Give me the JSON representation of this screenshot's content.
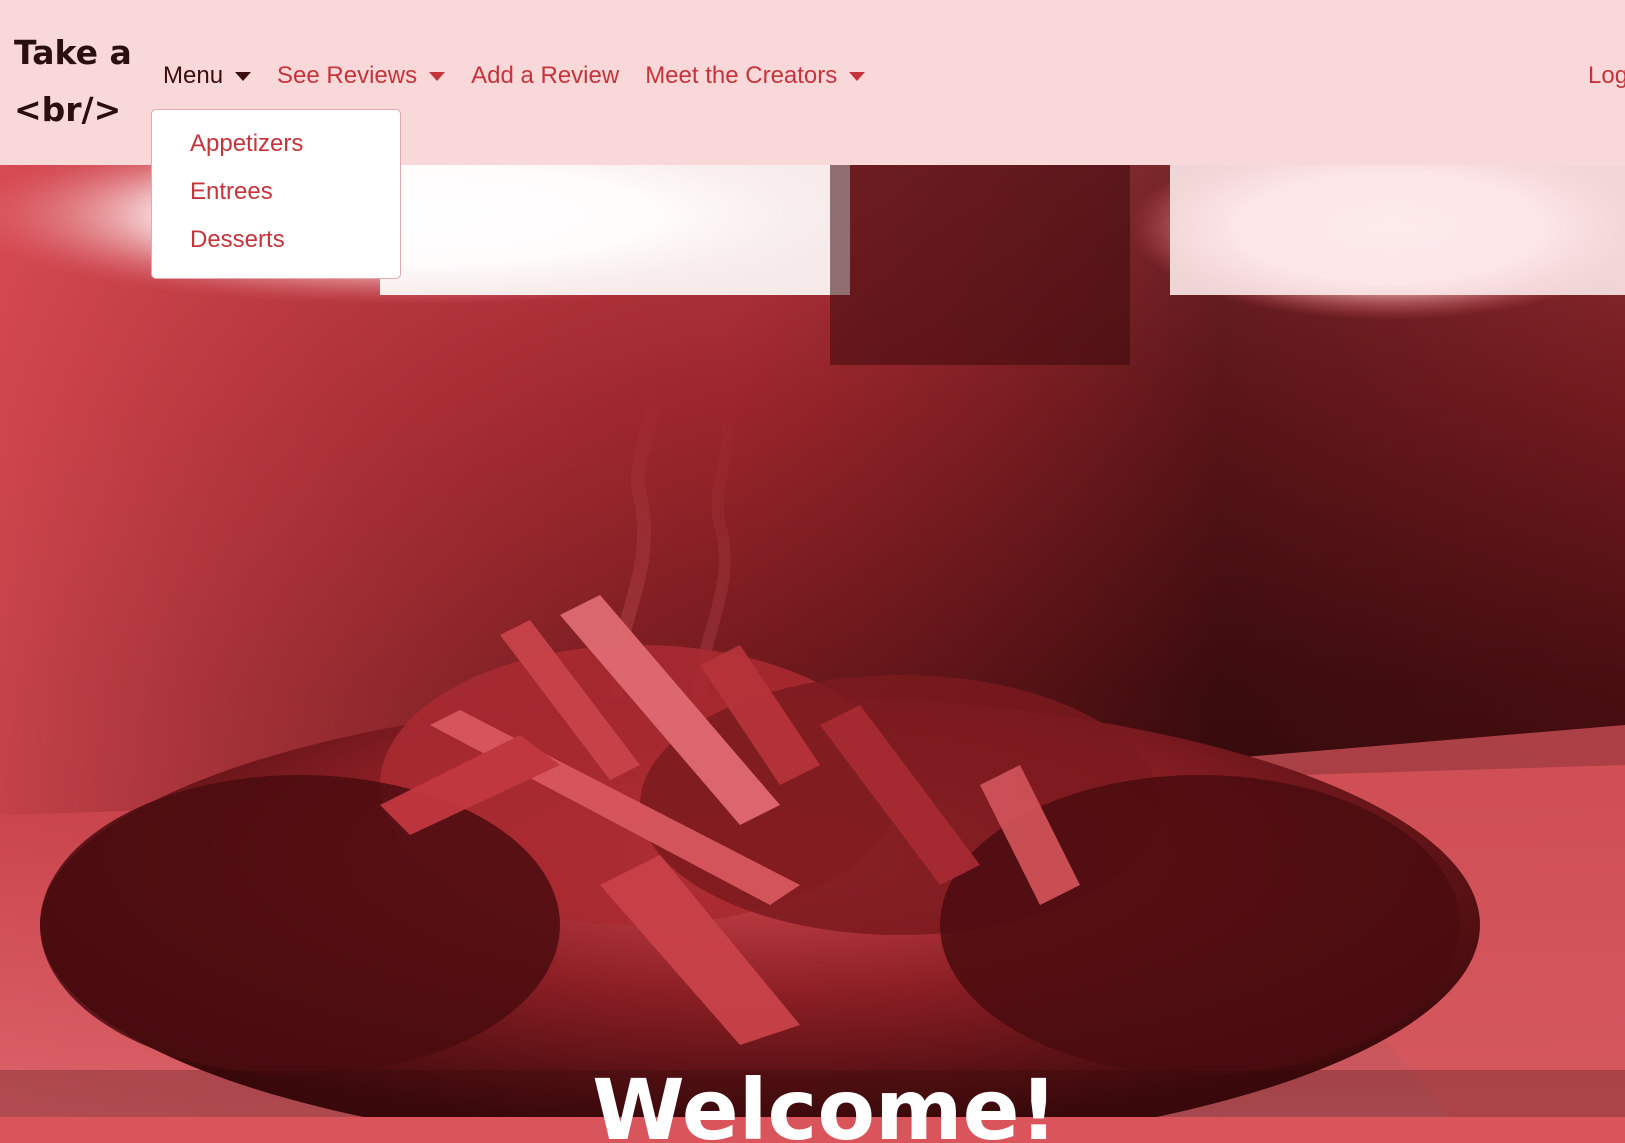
{
  "brand": {
    "line1": "Take a",
    "line2": "<br/>"
  },
  "nav": {
    "items": [
      {
        "label": "Menu",
        "has_caret": true,
        "active": true
      },
      {
        "label": "See Reviews",
        "has_caret": true,
        "active": false
      },
      {
        "label": "Add a Review",
        "has_caret": false,
        "active": false
      },
      {
        "label": "Meet the Creators",
        "has_caret": true,
        "active": false
      }
    ],
    "right_label": "Log"
  },
  "dropdown": {
    "items": [
      "Appetizers",
      "Entrees",
      "Desserts"
    ]
  },
  "hero": {
    "heading": "Welcome!"
  },
  "colors": {
    "navbar_bg": "#f8d8d9",
    "link": "#c6343b",
    "active_link": "#3b0d0f",
    "hero_tint": "#c8353c",
    "bottom_bar": "#d9545b"
  }
}
